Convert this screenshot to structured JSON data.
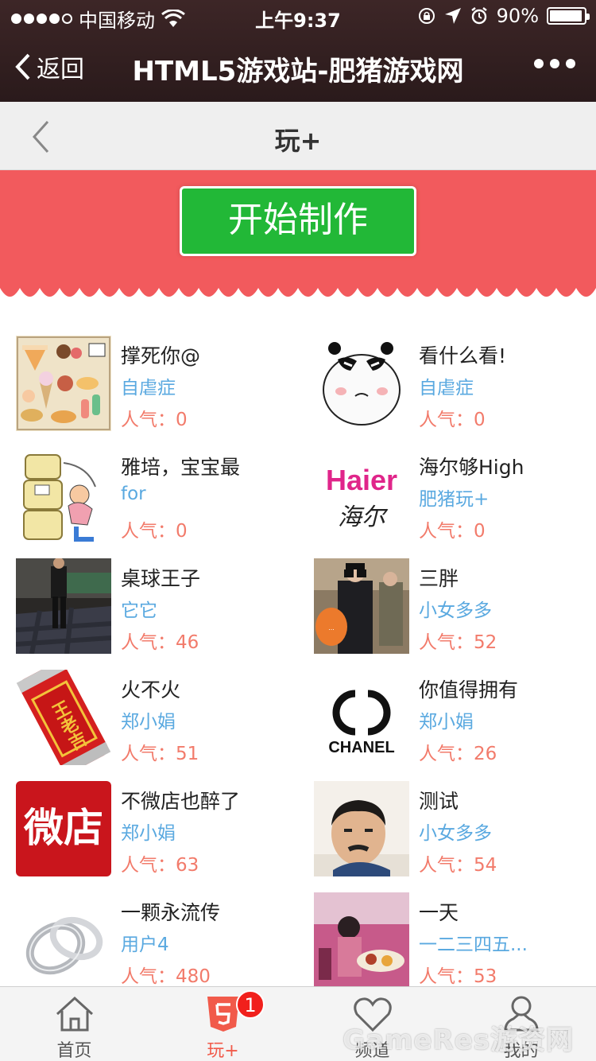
{
  "status_bar": {
    "carrier": "中国移动",
    "time": "上午9:37",
    "battery": "90%"
  },
  "wechat_nav": {
    "back_label": "返回",
    "title": "HTML5游戏站-肥猪游戏网"
  },
  "page": {
    "title": "玩+"
  },
  "banner": {
    "start_label": "开始制作",
    "color": "#f25a5d",
    "button_color": "#22b837"
  },
  "popularity_label": "人气：",
  "items": [
    {
      "title": "撑死你@",
      "author": "自虐症",
      "popularity": "0",
      "thumb_icon": "sweets-icon"
    },
    {
      "title": "看什么看!",
      "author": "自虐症",
      "popularity": "0",
      "thumb_icon": "panda-face-icon"
    },
    {
      "title": "雅培，宝宝最",
      "author": "for",
      "popularity": "0",
      "thumb_icon": "milk-cans-icon"
    },
    {
      "title": "海尔够High",
      "author": "肥猪玩+",
      "popularity": "0",
      "thumb_icon": "haier-logo-icon",
      "logo_text": "Haier",
      "logo_sub": "海尔"
    },
    {
      "title": "桌球王子",
      "author": "它它",
      "popularity": "46",
      "thumb_icon": "billiards-photo-icon"
    },
    {
      "title": "三胖",
      "author": "小女多多",
      "popularity": "52",
      "thumb_icon": "binoculars-photo-icon"
    },
    {
      "title": "火不火",
      "author": "郑小娟",
      "popularity": "51",
      "thumb_icon": "wanglaoji-can-icon",
      "can_text": "王老吉"
    },
    {
      "title": "你值得拥有",
      "author": "郑小娟",
      "popularity": "26",
      "thumb_icon": "chanel-logo-icon",
      "logo_text": "CHANEL"
    },
    {
      "title": "不微店也醉了",
      "author": "郑小娟",
      "popularity": "63",
      "thumb_icon": "weidian-logo-icon",
      "logo_text": "微店"
    },
    {
      "title": "测试",
      "author": "小女多多",
      "popularity": "54",
      "thumb_icon": "boy-photo-icon"
    },
    {
      "title": "一颗永流传",
      "author": "用户4",
      "popularity": "480",
      "thumb_icon": "rings-icon"
    },
    {
      "title": "一天",
      "author": "一二三四五...",
      "popularity": "53",
      "thumb_icon": "party-photo-icon"
    }
  ],
  "tabs": [
    {
      "label": "首页",
      "icon": "home-icon"
    },
    {
      "label": "玩+",
      "icon": "html5-icon",
      "badge": "1",
      "active": true
    },
    {
      "label": "频道",
      "icon": "heart-icon"
    },
    {
      "label": "我的",
      "icon": "user-icon"
    }
  ],
  "watermark": "GameRes游资网"
}
